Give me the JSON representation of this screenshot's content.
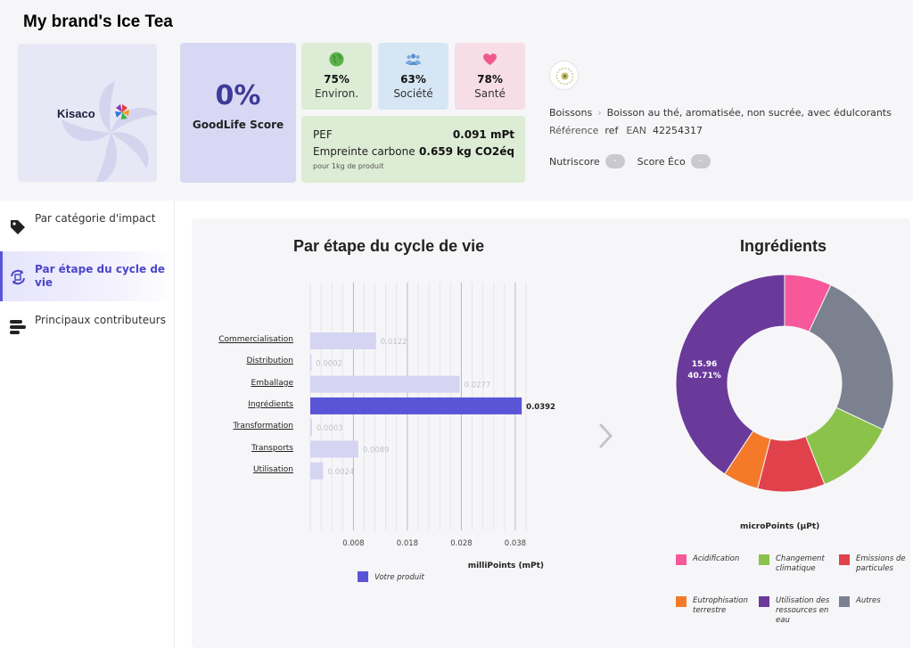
{
  "product": {
    "title": "My brand's Ice Tea",
    "brand_logo_text": "Kisaco"
  },
  "score": {
    "value": "0%",
    "label": "GoodLife Score"
  },
  "pillars": [
    {
      "pct": "75%",
      "label": "Environ.",
      "icon": "globe-icon",
      "color": "#5bb04a"
    },
    {
      "pct": "63%",
      "label": "Société",
      "icon": "people-icon",
      "color": "#5a8fd1"
    },
    {
      "pct": "78%",
      "label": "Santé",
      "icon": "heart-icon",
      "color": "#ee5b8b"
    }
  ],
  "impact": {
    "pef_label": "PEF",
    "pef_value": "0.091 mPt",
    "carbon_label": "Empreinte carbone",
    "carbon_value": "0.659 kg CO2éq",
    "unit_note": "pour 1kg de produit"
  },
  "details": {
    "category": "Boissons",
    "subcategory": "Boisson au thé, aromatisée, non sucrée, avec édulcorants",
    "ref_label": "Référence",
    "ref_value": "ref",
    "ean_label": "EAN",
    "ean_value": "42254317",
    "nutriscore_label": "Nutriscore",
    "nutriscore_value": "-",
    "score_eco_label": "Score Éco",
    "score_eco_value": "-"
  },
  "sidebar": {
    "items": [
      {
        "label": "Par catégorie d'impact",
        "icon": "tag-icon",
        "active": false
      },
      {
        "label": "Par étape du cycle de vie",
        "icon": "cycle-icon",
        "active": true
      },
      {
        "label": "Principaux contributeurs",
        "icon": "bars-icon",
        "active": false
      }
    ]
  },
  "lifecycle_title": "Par étape du cycle de vie",
  "ingredients_title": "Ingrédients",
  "colors": {
    "accent": "#5a55d6",
    "bar_muted": "#d6d4f3"
  },
  "chart_data": [
    {
      "type": "bar",
      "orientation": "horizontal",
      "title": "Par étape du cycle de vie",
      "categories": [
        "Commercialisation",
        "Distribution",
        "Emballage",
        "Ingrédients",
        "Transformation",
        "Transports",
        "Utilisation"
      ],
      "values": [
        0.0122,
        0.0002,
        0.0277,
        0.0392,
        0.0003,
        0.0089,
        0.0024
      ],
      "value_labels": [
        "0.0122",
        "0.0002",
        "0.0277",
        "0.0392",
        "0.0003",
        "0.0089",
        "0.0024"
      ],
      "highlight": "Ingrédients",
      "xlim": [
        0,
        0.04
      ],
      "xticks": [
        0.008,
        0.018,
        0.028,
        0.038
      ],
      "xtick_labels": [
        "0.008",
        "0.018",
        "0.028",
        "0.038"
      ],
      "xlabel": "milliPoints (mPt)",
      "legend": [
        "Votre produit"
      ],
      "grid": true
    },
    {
      "type": "pie",
      "title": "Ingrédients",
      "donut": true,
      "slices": [
        {
          "name": "Acidification",
          "share": 0.07,
          "color": "#f6589a"
        },
        {
          "name": "Autres",
          "share": 0.25,
          "color": "#7b818f"
        },
        {
          "name": "Changement climatique",
          "share": 0.12,
          "color": "#8bc34a"
        },
        {
          "name": "Emissions de particules",
          "share": 0.1,
          "color": "#e1414a"
        },
        {
          "name": "Eutrophisation terrestre",
          "share": 0.0529,
          "color": "#f47a2a"
        },
        {
          "name": "Utilisation des ressources en eau",
          "share": 0.4071,
          "color": "#6a3a9b"
        }
      ],
      "callout": {
        "series": "Utilisation des ressources en eau",
        "value": "15.96",
        "percent": "40.71%"
      },
      "subtitle": "microPoints (µPt)",
      "legend_order": [
        "Acidification",
        "Changement climatique",
        "Emissions de particules",
        "Eutrophisation terrestre",
        "Utilisation des ressources en eau",
        "Autres"
      ]
    }
  ]
}
